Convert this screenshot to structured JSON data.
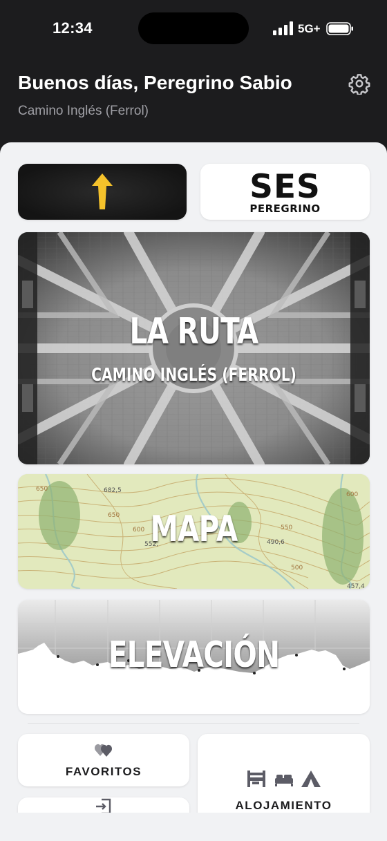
{
  "status_bar": {
    "time": "12:34",
    "network": "5G+"
  },
  "header": {
    "greeting": "Buenos días, Peregrino Sabio",
    "route": "Camino Inglés (Ferrol)"
  },
  "cards": {
    "ses": {
      "title": "SES",
      "subtitle": "PEREGRINO"
    },
    "ruta": {
      "title": "LA RUTA",
      "subtitle": "CAMINO INGLÉS (FERROL)"
    },
    "mapa": {
      "title": "MAPA",
      "elevation_labels": [
        "682,5",
        "650",
        "600",
        "552,",
        "490,6",
        "550",
        "500",
        "457,4",
        "650",
        "600"
      ]
    },
    "elevacion": {
      "title": "ELEVACIÓN"
    },
    "favoritos": {
      "label": "FAVORITOS"
    },
    "alojamiento": {
      "label": "ALOJAMIENTO"
    }
  },
  "icons": [
    "signal-icon",
    "battery-icon",
    "gear-icon",
    "arrow-up-icon",
    "hearts-icon",
    "login-icon",
    "hostel-bed-icon",
    "bed-icon",
    "tent-icon"
  ],
  "colors": {
    "header_bg": "#1c1c1e",
    "arrow_yellow": "#f5c22b",
    "sheet_bg": "#f1f2f4",
    "map_bg": "#dfe7b8"
  }
}
